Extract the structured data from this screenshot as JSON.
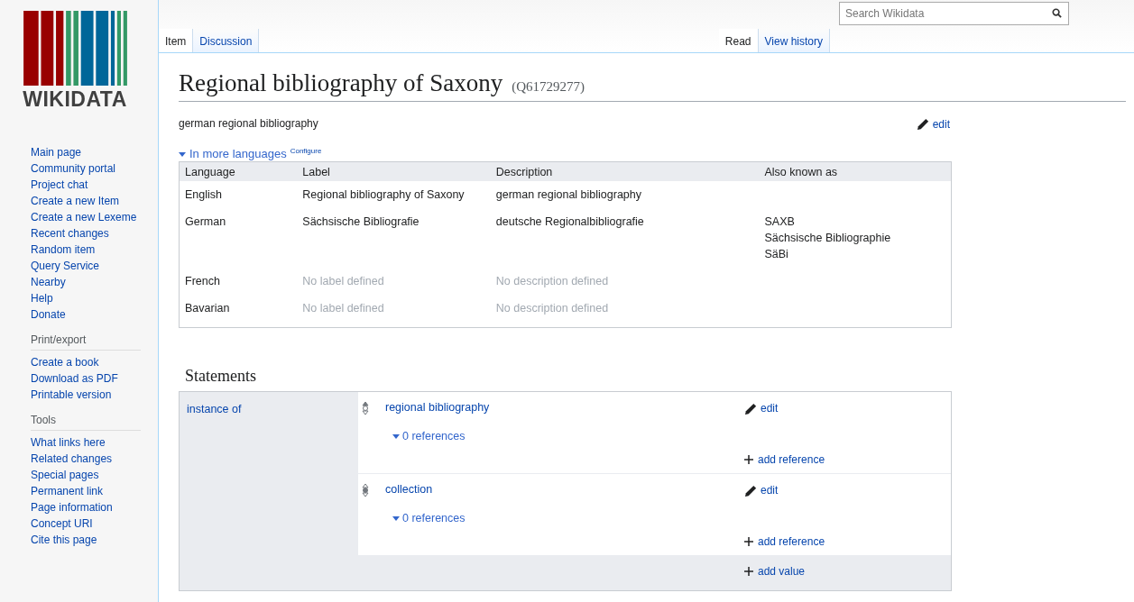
{
  "logo": {
    "text": "WIKIDATA"
  },
  "sidebar": {
    "navigation": [
      "Main page",
      "Community portal",
      "Project chat",
      "Create a new Item",
      "Create a new Lexeme",
      "Recent changes",
      "Random item",
      "Query Service",
      "Nearby",
      "Help",
      "Donate"
    ],
    "sections": [
      {
        "heading": "Print/export",
        "items": [
          "Create a book",
          "Download as PDF",
          "Printable version"
        ]
      },
      {
        "heading": "Tools",
        "items": [
          "What links here",
          "Related changes",
          "Special pages",
          "Permanent link",
          "Page information",
          "Concept URI",
          "Cite this page"
        ]
      }
    ]
  },
  "left_tabs": [
    {
      "label": "Item",
      "selected": true
    },
    {
      "label": "Discussion",
      "selected": false
    }
  ],
  "right_tabs": [
    {
      "label": "Read",
      "selected": true
    },
    {
      "label": "View history",
      "selected": false
    }
  ],
  "search": {
    "placeholder": "Search Wikidata"
  },
  "title": {
    "label": "Regional bibliography of Saxony",
    "id": "(Q61729277)"
  },
  "description": "german regional bibliography",
  "edit_link": "edit",
  "languages": {
    "toggle": "In more languages",
    "configure": "Configure",
    "expanded": true,
    "columns": [
      "Language",
      "Label",
      "Description",
      "Also known as"
    ],
    "rows": [
      {
        "language": "English",
        "label": "Regional bibliography of Saxony",
        "label_missing": false,
        "description": "german regional bibliography",
        "description_missing": false,
        "aliases": []
      },
      {
        "language": "German",
        "label": "Sächsische Bibliografie",
        "label_missing": false,
        "description": "deutsche Regionalbibliografie",
        "description_missing": false,
        "aliases": [
          "SAXB",
          "Sächsische Bibliographie",
          "SäBi"
        ]
      },
      {
        "language": "French",
        "label": "No label defined",
        "label_missing": true,
        "description": "No description defined",
        "description_missing": true,
        "aliases": []
      },
      {
        "language": "Bavarian",
        "label": "No label defined",
        "label_missing": true,
        "description": "No description defined",
        "description_missing": true,
        "aliases": []
      }
    ]
  },
  "statements": {
    "heading": "Statements",
    "groups": [
      {
        "property": "instance of",
        "add_value": "add value",
        "values": [
          {
            "value": "regional bibliography",
            "kind": "preferred",
            "edit": "edit",
            "references": "0 references",
            "add_reference": "add reference"
          },
          {
            "value": "collection",
            "kind": "normal",
            "edit": "edit",
            "references": "0 references",
            "add_reference": "add reference"
          }
        ]
      }
    ]
  }
}
